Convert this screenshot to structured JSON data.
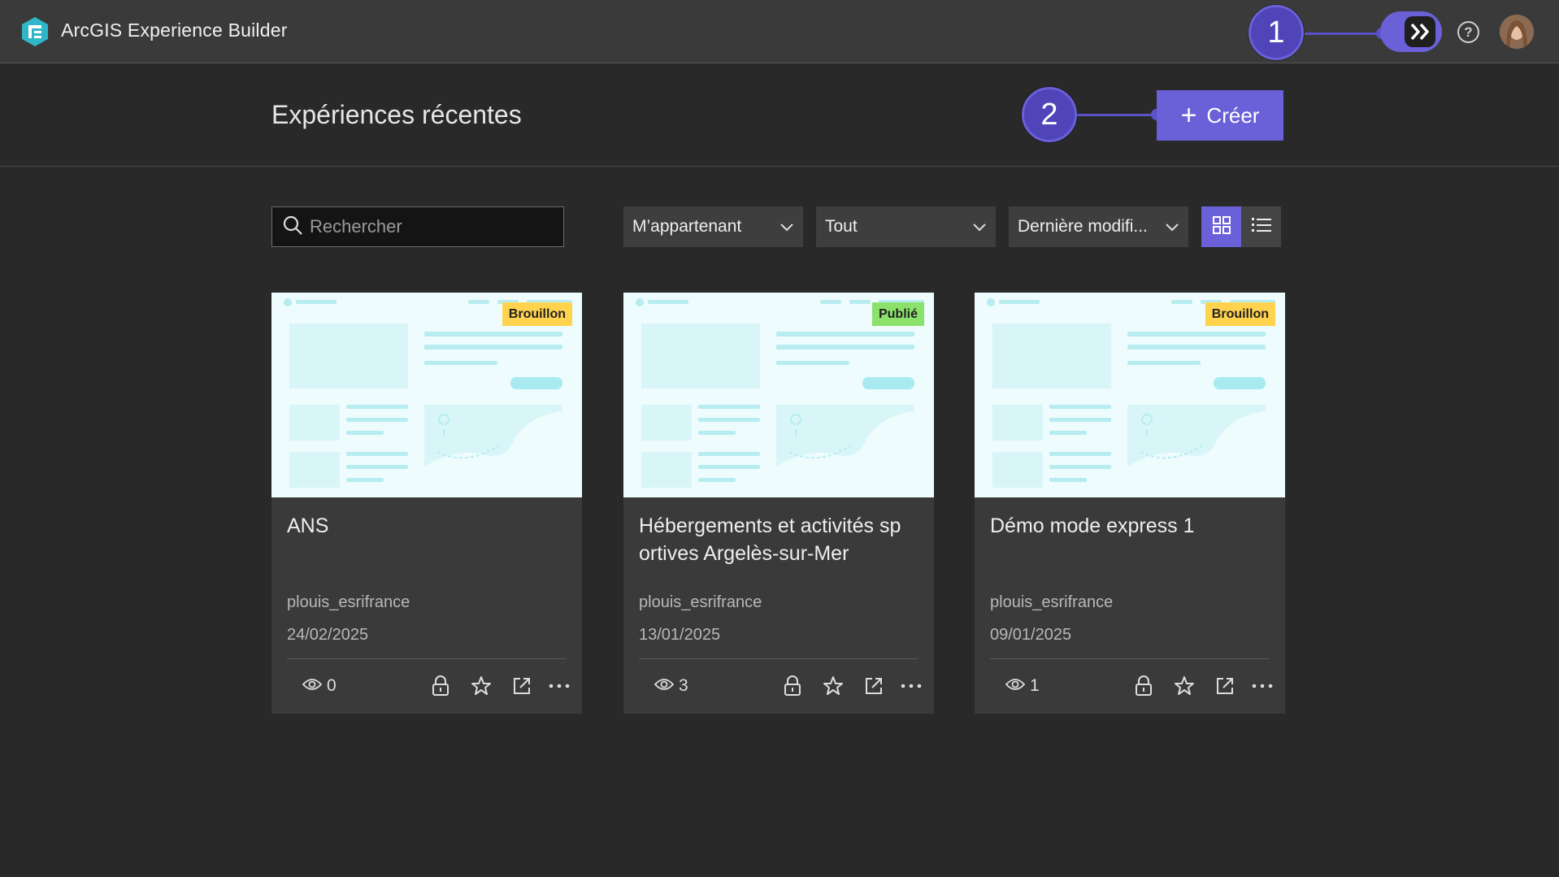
{
  "app": {
    "title": "ArcGIS Experience Builder"
  },
  "callouts": {
    "one": "1",
    "two": "2"
  },
  "page": {
    "title": "Expériences récentes",
    "create_label": "Créer"
  },
  "filters": {
    "search_placeholder": "Rechercher",
    "owner": "M’appartenant",
    "status": "Tout",
    "sort": "Dernière modifi..."
  },
  "colors": {
    "accent": "#6a60d8",
    "draft": "#ffd34d",
    "published": "#8be26b"
  },
  "cards": [
    {
      "title": "ANS",
      "status": "Brouillon",
      "owner": "plouis_esrifrance",
      "date": "24/02/2025",
      "views": "0"
    },
    {
      "title": "Hébergements et activités sp ortives Argelès-sur-Mer",
      "status": "Publié",
      "owner": "plouis_esrifrance",
      "date": "13/01/2025",
      "views": "3"
    },
    {
      "title": "Démo mode express 1",
      "status": "Brouillon",
      "owner": "plouis_esrifrance",
      "date": "09/01/2025",
      "views": "1"
    }
  ]
}
